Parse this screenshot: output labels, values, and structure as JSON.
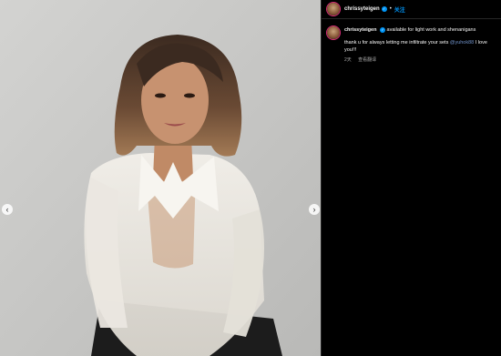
{
  "post": {
    "username": "chrissyteigen",
    "follow_label": "关注",
    "dot": "•",
    "verified_glyph": "✓"
  },
  "caption": {
    "username": "chrissyteigen",
    "bio": "available for light work and shenanigans",
    "text_before": "thank u for always letting me infiltrate your sets ",
    "mention": "@yuhok88",
    "text_after": " I love you!!!",
    "time": "2天",
    "translate_label": "查看翻译"
  },
  "navigation": {
    "prev_glyph": "‹",
    "next_glyph": "›"
  },
  "colors": {
    "background": "#000000",
    "accent": "#0095f6",
    "muted": "#a8a8a8"
  }
}
